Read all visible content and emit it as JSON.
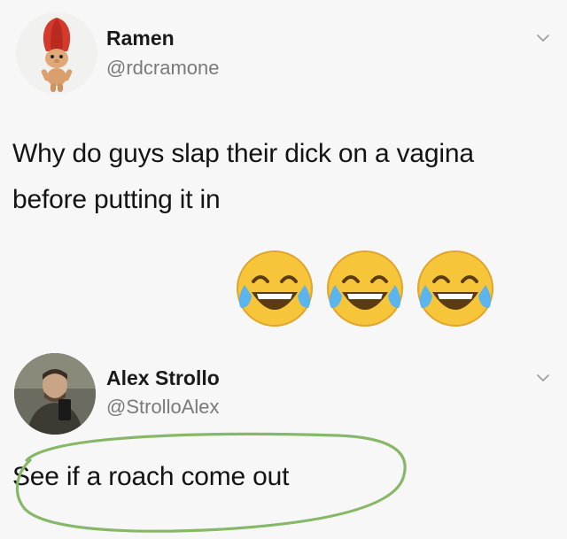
{
  "tweets": [
    {
      "name": "Ramen",
      "handle": "@rdcramone",
      "text_line1": "Why do guys slap their dick on a vagina",
      "text_line2": "before putting it in",
      "emoji_count": 3,
      "emoji_icon": "face-with-tears-of-joy-icon"
    },
    {
      "name": "Alex Strollo",
      "handle": "@StrolloAlex",
      "text": "See if a roach come out"
    }
  ],
  "colors": {
    "annotation": "#86b867",
    "handle": "#7a7a7a",
    "emoji_face": "#f7c53a"
  }
}
